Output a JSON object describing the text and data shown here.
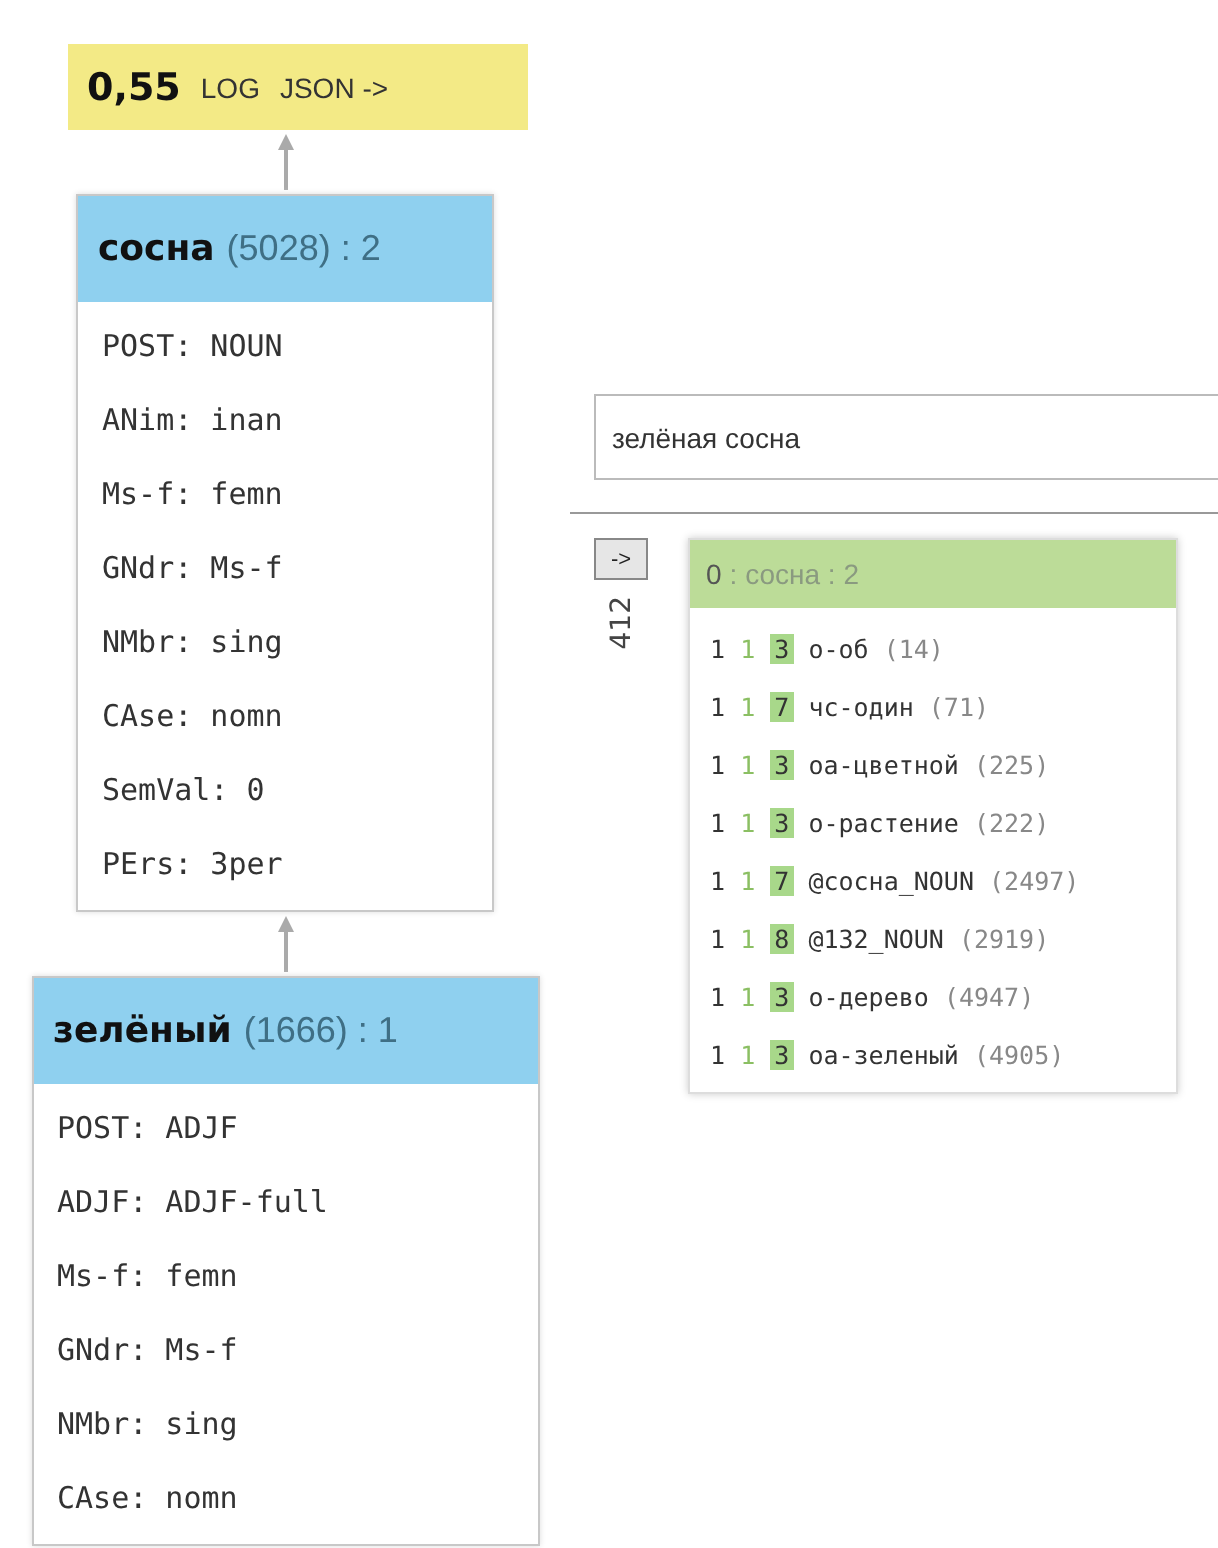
{
  "score_bar": {
    "score": "0,55",
    "links": [
      "LOG",
      "JSON ->"
    ]
  },
  "nodes": [
    {
      "word": "сосна",
      "count": "(5028) : 2",
      "features": [
        "POST: NOUN",
        "ANim: inan",
        "Ms-f: femn",
        "GNdr: Ms-f",
        "NMbr: sing",
        "CAse: nomn",
        "SemVal: 0",
        "PErs: 3per"
      ]
    },
    {
      "word": "зелёный",
      "count": "(1666) : 1",
      "features": [
        "POST: ADJF",
        "ADJF: ADJF-full",
        "Ms-f: femn",
        "GNdr: Ms-f",
        "NMbr: sing",
        "CAse: nomn"
      ]
    }
  ],
  "query": {
    "value": "зелёная сосна"
  },
  "result": {
    "button": "->",
    "side_count": "412",
    "header_index": "0",
    "header_rest": ": сосна : 2",
    "rows": [
      {
        "col_1": "1",
        "col_2": "1",
        "weight": "3",
        "name": "о-об",
        "count": "(14)"
      },
      {
        "col_1": "1",
        "col_2": "1",
        "weight": "7",
        "name": "чс-один",
        "count": "(71)"
      },
      {
        "col_1": "1",
        "col_2": "1",
        "weight": "3",
        "name": "оа-цветной",
        "count": "(225)"
      },
      {
        "col_1": "1",
        "col_2": "1",
        "weight": "3",
        "name": "о-растение",
        "count": "(222)"
      },
      {
        "col_1": "1",
        "col_2": "1",
        "weight": "7",
        "name": "@сосна_NOUN",
        "count": "(2497)"
      },
      {
        "col_1": "1",
        "col_2": "1",
        "weight": "8",
        "name": "@132_NOUN",
        "count": "(2919)"
      },
      {
        "col_1": "1",
        "col_2": "1",
        "weight": "3",
        "name": "о-дерево",
        "count": "(4947)"
      },
      {
        "col_1": "1",
        "col_2": "1",
        "weight": "3",
        "name": "оа-зеленый",
        "count": "(4905)"
      }
    ]
  }
}
